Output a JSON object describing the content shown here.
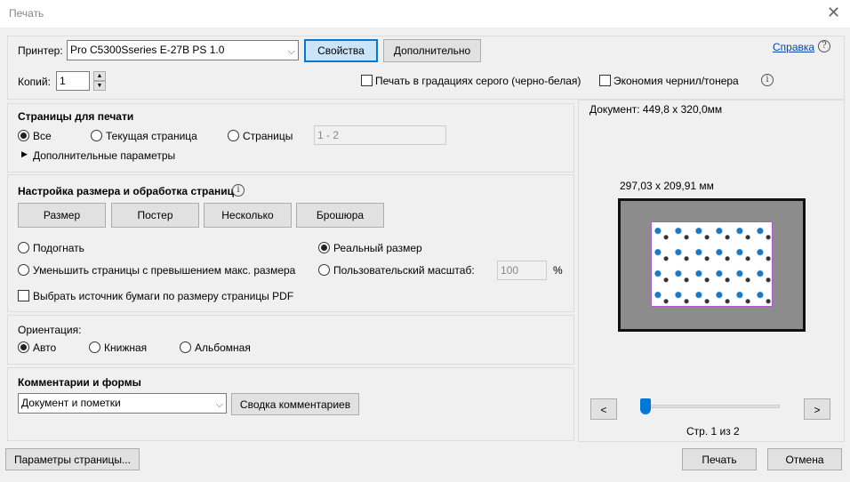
{
  "window": {
    "title": "Печать",
    "close": "✕"
  },
  "top": {
    "printer_label": "Принтер:",
    "printer_value": "Pro C5300Sseries E-27B PS 1.0",
    "properties": "Свойства",
    "advanced": "Дополнительно",
    "help": "Справка",
    "copies_label": "Копий:",
    "copies_value": "1",
    "grayscale": "Печать в градациях серого (черно-белая)",
    "save_ink": "Экономия чернил/тонера"
  },
  "pages": {
    "heading": "Страницы для печати",
    "all": "Все",
    "current": "Текущая страница",
    "pages": "Страницы",
    "range": "1 - 2",
    "more": "Дополнительные параметры"
  },
  "sizing": {
    "heading": "Настройка размера и обработка страниц",
    "tabs": [
      "Размер",
      "Постер",
      "Несколько",
      "Брошюра"
    ],
    "fit": "Подогнать",
    "actual": "Реальный размер",
    "shrink": "Уменьшить страницы с превышением макс. размера",
    "custom": "Пользовательский масштаб:",
    "scale": "100",
    "percent": "%",
    "paper_source": "Выбрать источник бумаги по размеру страницы PDF"
  },
  "orientation": {
    "heading": "Ориентация:",
    "auto": "Авто",
    "portrait": "Книжная",
    "landscape": "Альбомная"
  },
  "comments": {
    "heading": "Комментарии и формы",
    "value": "Документ и пометки",
    "summary": "Сводка комментариев"
  },
  "preview": {
    "document": "Документ: 449,8 x 320,0мм",
    "size": "297,03 x 209,91 мм",
    "prev": "<",
    "next": ">",
    "page": "Стр. 1 из 2",
    "page_fraction": 0
  },
  "bottom": {
    "page_setup": "Параметры страницы...",
    "print": "Печать",
    "cancel": "Отмена"
  }
}
